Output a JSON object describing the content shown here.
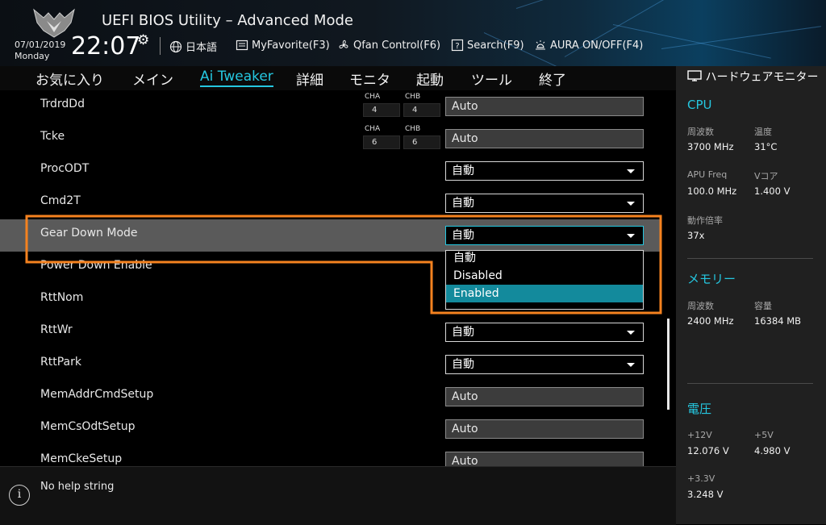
{
  "header": {
    "title": "UEFI BIOS Utility – Advanced Mode",
    "date": "07/01/2019",
    "day": "Monday",
    "time": "22:07",
    "buttons": [
      {
        "label": "日本語",
        "icon": "globe-icon"
      },
      {
        "label": "MyFavorite(F3)",
        "icon": "favorite-list-icon"
      },
      {
        "label": "Qfan Control(F6)",
        "icon": "fan-icon"
      },
      {
        "label": "Search(F9)",
        "icon": "search-help-icon"
      },
      {
        "label": "AURA ON/OFF(F4)",
        "icon": "aura-light-icon"
      }
    ]
  },
  "nav": {
    "tabs": [
      "お気に入り",
      "メイン",
      "Ai Tweaker",
      "詳細",
      "モニタ",
      "起動",
      "ツール",
      "終了"
    ],
    "active": "Ai Tweaker"
  },
  "settings": [
    {
      "label": "TrdrdDd",
      "cha_label": "CHA",
      "cha": "4",
      "chb_label": "CHB",
      "chb": "4",
      "value": "Auto"
    },
    {
      "label": "Tcke",
      "cha_label": "CHA",
      "cha": "6",
      "chb_label": "CHB",
      "chb": "6",
      "value": "Auto"
    },
    {
      "label": "ProcODT",
      "value": "自動"
    },
    {
      "label": "Cmd2T",
      "value": "自動"
    },
    {
      "label": "Gear Down Mode",
      "value": "自動"
    },
    {
      "label": "Power Down Enable",
      "value": ""
    },
    {
      "label": "RttNom",
      "value": ""
    },
    {
      "label": "RttWr",
      "value": "自動"
    },
    {
      "label": "RttPark",
      "value": "自動"
    },
    {
      "label": "MemAddrCmdSetup",
      "value": "Auto"
    },
    {
      "label": "MemCsOdtSetup",
      "value": "Auto"
    },
    {
      "label": "MemCkeSetup",
      "value": "Auto"
    }
  ],
  "dropdown": {
    "options": [
      "自動",
      "Disabled",
      "Enabled"
    ],
    "highlighted": "Enabled"
  },
  "help": {
    "text": "No help string"
  },
  "hardware_monitor": {
    "title": "ハードウェアモニター",
    "cpu": {
      "title": "CPU",
      "freq_label": "周波数",
      "freq": "3700 MHz",
      "temp_label": "温度",
      "temp": "31°C",
      "apu_label": "APU Freq",
      "apu": "100.0 MHz",
      "vcore_label": "Vコア",
      "vcore": "1.400 V",
      "ratio_label": "動作倍率",
      "ratio": "37x"
    },
    "memory": {
      "title": "メモリー",
      "freq_label": "周波数",
      "freq": "2400 MHz",
      "cap_label": "容量",
      "cap": "16384 MB"
    },
    "voltage": {
      "title": "電圧",
      "v12_label": "+12V",
      "v12": "12.076 V",
      "v5_label": "+5V",
      "v5": "4.980 V",
      "v33_label": "+3.3V",
      "v33": "3.248 V"
    }
  },
  "colors": {
    "accent": "#25c7e0",
    "annotation": "#f5821f",
    "highlight_row": "#5a5a5a",
    "selected_option": "#138a9c"
  }
}
